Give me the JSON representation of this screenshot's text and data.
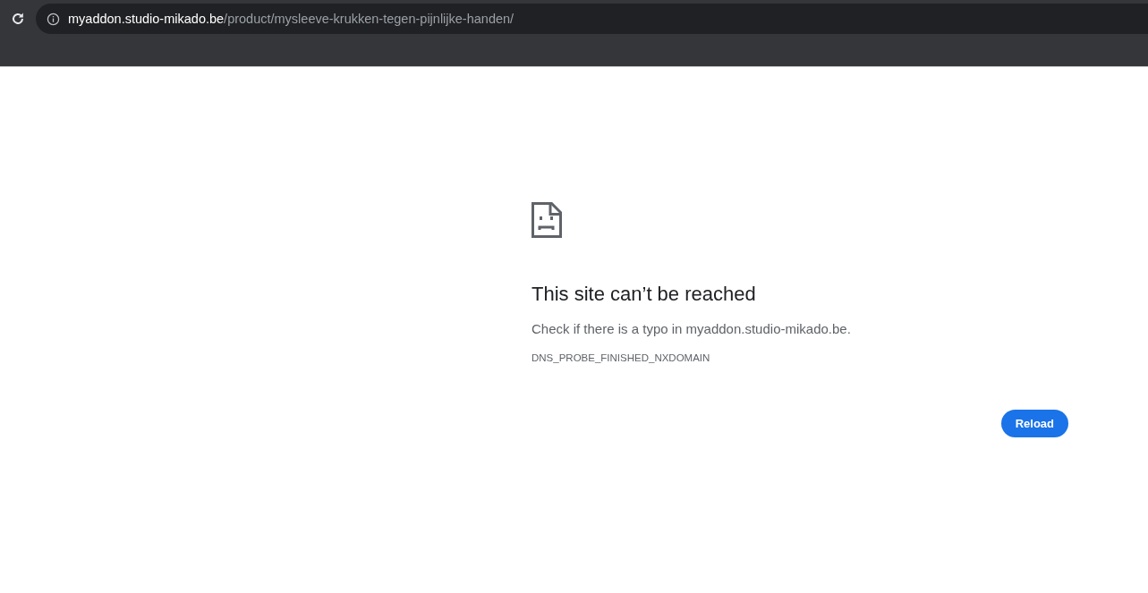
{
  "browser": {
    "address_bar": {
      "host": "myaddon.studio-mikado.be",
      "path": "/product/mysleeve-krukken-tegen-pijnlijke-handen/"
    }
  },
  "error_page": {
    "title": "This site can’t be reached",
    "message": "Check if there is a typo in myaddon.studio-mikado.be.",
    "error_code": "DNS_PROBE_FINISHED_NXDOMAIN",
    "buttons": [
      "Reload"
    ]
  }
}
